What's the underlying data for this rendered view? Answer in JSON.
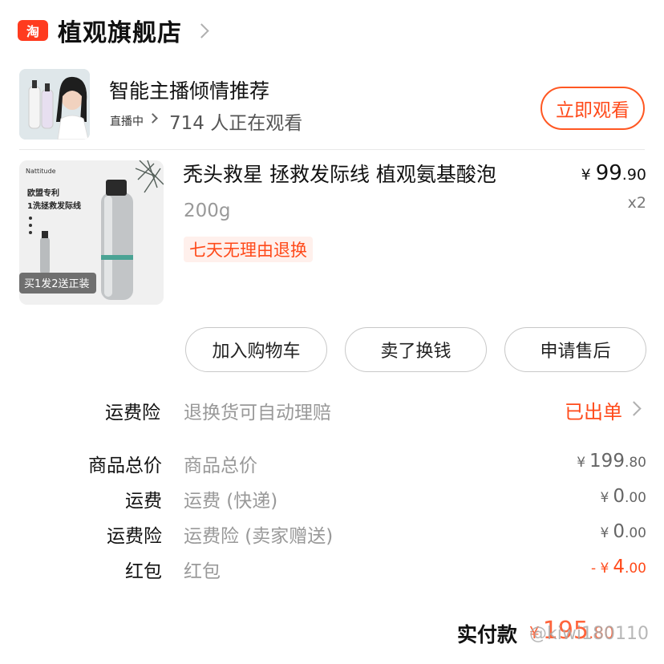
{
  "store": {
    "name": "植观旗舰店",
    "logo_text": "淘"
  },
  "live": {
    "title": "智能主播倾情推荐",
    "status": "直播中",
    "viewers": "714 人正在观看",
    "watch_label": "立即观看"
  },
  "product": {
    "title": "秃头救星 拯救发际线 植观氨基酸泡",
    "spec": "200g",
    "badge": "七天无理由退换",
    "price_symbol": "¥",
    "price_int": "99",
    "price_dec": ".90",
    "quantity": "x2",
    "image_texts": {
      "brand": "Nattitude",
      "patent": "欧盟专利",
      "slogan": "1洗拯救发际线",
      "promo": "买1发2送正装"
    }
  },
  "actions": {
    "add_to_cart": "加入购物车",
    "sell": "卖了换钱",
    "after_sale": "申请售后"
  },
  "insurance": {
    "label": "运费险",
    "desc": "退换货可自动理赔",
    "status": "已出单"
  },
  "summary": [
    {
      "label": "商品总价",
      "desc": "商品总价",
      "symbol": "¥",
      "int": "199",
      "dec": ".80",
      "discount": false
    },
    {
      "label": "运费",
      "desc": "运费 (快递)",
      "symbol": "¥",
      "int": "0",
      "dec": ".00",
      "discount": false
    },
    {
      "label": "运费险",
      "desc": "运费险 (卖家赠送)",
      "symbol": "¥",
      "int": "0",
      "dec": ".00",
      "discount": false
    },
    {
      "label": "红包",
      "desc": "红包",
      "symbol": "- ¥",
      "int": "4",
      "dec": ".00",
      "discount": true
    }
  ],
  "total": {
    "label": "实付款",
    "symbol": "¥",
    "int": "195",
    "dec": ".80"
  },
  "watermark": "@kiwi180110",
  "colors": {
    "accent": "#ff4a1a",
    "muted": "#999999",
    "border": "#c8c8c8"
  }
}
